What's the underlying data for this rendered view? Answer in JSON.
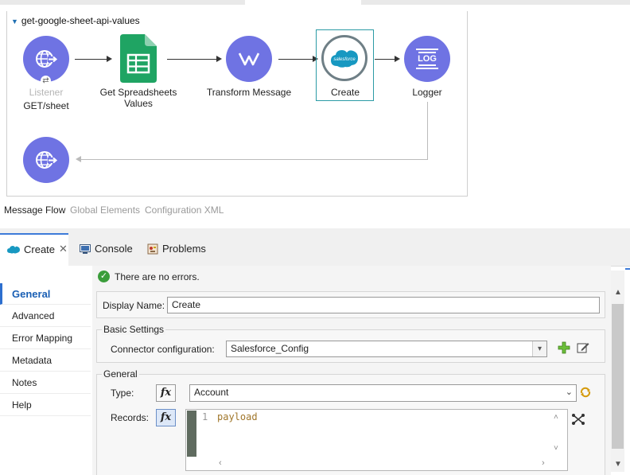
{
  "flow": {
    "title": "get-google-sheet-api-values",
    "nodes": {
      "listener": {
        "label1": "Listener",
        "label2": "GET/sheet",
        "icon": "globe-arrow-icon"
      },
      "sheets": {
        "label": "Get Spreadsheets Values",
        "icon": "google-sheets-icon"
      },
      "transform": {
        "label": "Transform Message",
        "icon": "dataweave-icon"
      },
      "create": {
        "label": "Create",
        "icon": "salesforce-icon",
        "logo_text": "salesforce"
      },
      "logger": {
        "label": "Logger",
        "icon": "log-icon",
        "logo_text": "LOG"
      }
    }
  },
  "editor_tabs": [
    "Message Flow",
    "Global Elements",
    "Configuration XML"
  ],
  "panel_tabs": {
    "create": "Create",
    "console": "Console",
    "problems": "Problems"
  },
  "sidebar": {
    "items": [
      "General",
      "Advanced",
      "Error Mapping",
      "Metadata",
      "Notes",
      "Help"
    ]
  },
  "form": {
    "status": "There are no errors.",
    "display_name_label": "Display Name:",
    "display_name_value": "Create",
    "basic_settings_title": "Basic Settings",
    "connector_label": "Connector configuration:",
    "connector_value": "Salesforce_Config",
    "general_title": "General",
    "type_label": "Type:",
    "type_value": "Account",
    "records_label": "Records:",
    "fx": "fx",
    "code_line_number": "1",
    "code_value": "payload"
  },
  "colors": {
    "node_purple": "#6f73e3",
    "sheets_green": "#1fa463",
    "salesforce_blue": "#1798c1",
    "active_tab_blue": "#3d7bd9"
  }
}
